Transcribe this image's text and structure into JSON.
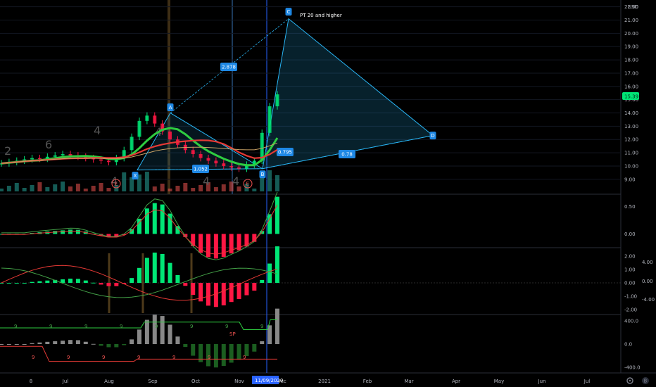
{
  "currency": "USD",
  "last_price": "15.39",
  "crosshair_date": "11/09/2020",
  "colors": {
    "up": "#26a69a",
    "down": "#ef5350",
    "bright_up": "#00e676",
    "bright_down": "#ff1744",
    "pattern": "#29b6f6",
    "last_price_bg": "#00e676",
    "crosshair": "#2962ff"
  },
  "chart_data": [
    {
      "type": "line",
      "pane": "price",
      "y_axis_ticks": [
        "22.00",
        "21.00",
        "20.00",
        "19.00",
        "18.00",
        "17.00",
        "16.00",
        "15.00",
        "14.00",
        "13.00",
        "12.00",
        "11.00",
        "10.00",
        "9.00"
      ],
      "y_values": [
        22,
        21,
        20,
        19,
        18,
        17,
        16,
        15,
        14,
        13,
        12,
        11,
        10,
        9
      ],
      "ylim": [
        8.3,
        22.3
      ],
      "harmonic_pattern": {
        "points": [
          {
            "label": "X",
            "date_index": 0,
            "y": 9.7
          },
          {
            "label": "A",
            "date_index": 1,
            "y": 14.0
          },
          {
            "label": "B",
            "date_index": 2,
            "y": 9.8
          },
          {
            "label": "C",
            "date_index": 3,
            "y": 21.1
          },
          {
            "label": "D",
            "date_index": 4,
            "y": 12.3
          }
        ],
        "ratios": [
          {
            "text": "2.878"
          },
          {
            "text": "1.052"
          },
          {
            "text": "0.795"
          },
          {
            "text": "0.78"
          }
        ],
        "annotation": "PT 20 and higher"
      },
      "price_closes": [
        10.2,
        10.3,
        10.4,
        10.5,
        10.6,
        10.55,
        10.7,
        10.8,
        10.9,
        10.8,
        10.7,
        10.6,
        10.5,
        10.4,
        10.3,
        10.6,
        11.2,
        12.2,
        13.4,
        13.8,
        13.2,
        12.6,
        12.0,
        11.6,
        11.2,
        10.9,
        10.6,
        10.4,
        10.2,
        10.0,
        9.9,
        9.8,
        10.1,
        10.4,
        12.5,
        14.5,
        15.4
      ],
      "numeric_labels": [
        "2",
        "6",
        "4",
        "4",
        "4",
        "4",
        "4"
      ],
      "earnings_markers": [
        "E",
        "E"
      ]
    },
    {
      "type": "bar",
      "pane": "macd",
      "y_axis_ticks": [
        "0.50",
        "0.00"
      ],
      "y_values": [
        0.5,
        0.0
      ],
      "ylim": [
        -0.2,
        0.65
      ]
    },
    {
      "type": "bar",
      "pane": "oscillator",
      "y_axis_ticks": [
        "2.00",
        "1.00",
        "0.00",
        "-1.00",
        "-2.00"
      ],
      "y_values": [
        2,
        1,
        0,
        -1,
        -2
      ],
      "secondary_ticks": [
        "4.00",
        "0.00",
        "-4.00"
      ],
      "ylim": [
        -2.1,
        2.1
      ]
    },
    {
      "type": "bar",
      "pane": "signals",
      "y_axis_ticks": [
        "400.0",
        "0.0",
        "-400.0"
      ],
      "y_values": [
        400,
        0,
        -400
      ],
      "ylim": [
        -450,
        450
      ],
      "text_marks": [
        "9",
        "9",
        "9",
        "9",
        "9",
        "9",
        "9",
        "9",
        "9",
        "9",
        "9",
        "9",
        "9",
        "9",
        "9"
      ],
      "sp_label": "SP"
    }
  ],
  "x_axis": {
    "ticks": [
      "8",
      "Jul",
      "Aug",
      "Sep",
      "Oct",
      "Nov",
      "Dec",
      "2021",
      "Feb",
      "Mar",
      "Apr",
      "May",
      "Jun",
      "Jul"
    ]
  },
  "icons": {
    "settings": "gear-icon",
    "logo": "tradingview-logo-icon"
  }
}
